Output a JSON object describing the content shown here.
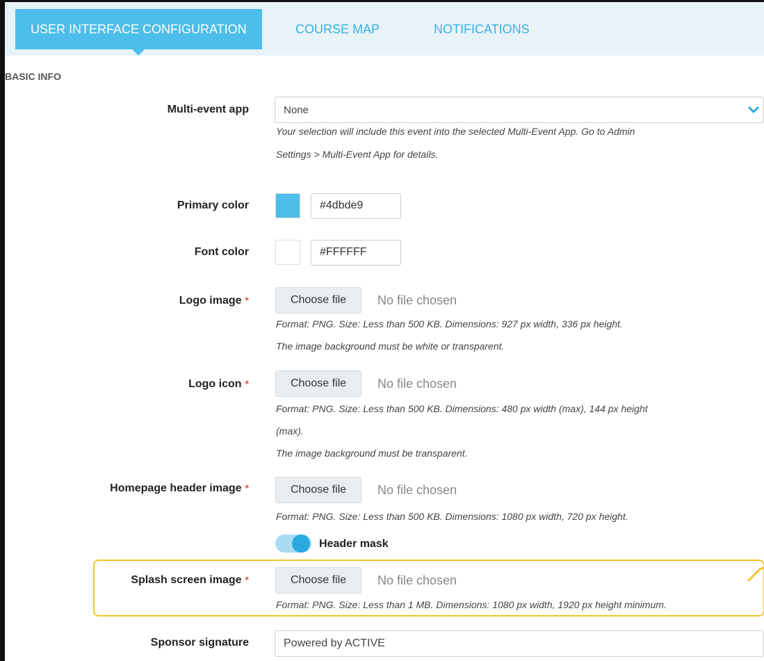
{
  "tabs": [
    {
      "label": "USER INTERFACE CONFIGURATION",
      "active": true
    },
    {
      "label": "COURSE MAP",
      "active": false
    },
    {
      "label": "NOTIFICATIONS",
      "active": false
    }
  ],
  "section_title": "BASIC INFO",
  "multi_event": {
    "label": "Multi-event app",
    "value": "None",
    "help_line1": "Your selection will include this event into the selected Multi-Event App. Go to Admin",
    "help_line2": "Settings > Multi-Event App for details."
  },
  "primary_color": {
    "label": "Primary color",
    "value": "#4dbde9",
    "swatch": "#4dbde9"
  },
  "font_color": {
    "label": "Font color",
    "value": "#FFFFFF",
    "swatch": "#FFFFFF"
  },
  "required_mark": "*",
  "file_button": "Choose file",
  "no_file": "No file chosen",
  "logo_image": {
    "label": "Logo image",
    "help_line1": "Format: PNG. Size: Less than 500 KB. Dimensions: 927 px width, 336 px height.",
    "help_line2": "The image background must be white or transparent."
  },
  "logo_icon": {
    "label": "Logo icon",
    "help_line1": "Format: PNG. Size: Less than 500 KB. Dimensions: 480 px width (max), 144 px height",
    "help_line2": "(max).",
    "help_line3": "The image background must be transparent."
  },
  "homepage_header": {
    "label": "Homepage header image",
    "help_line1": "Format: PNG. Size: Less than 500 KB. Dimensions: 1080 px width, 720 px height.",
    "toggle_label": "Header mask",
    "toggle_on": true
  },
  "splash_screen": {
    "label": "Splash screen image",
    "help_line1": "Format: PNG. Size: Less than 1 MB. Dimensions: 1080 px width, 1920 px height minimum."
  },
  "sponsor": {
    "label": "Sponsor signature",
    "value": "Powered by ACTIVE"
  },
  "colors": {
    "accent": "#4dbde9",
    "highlight": "#f2c232",
    "required": "#e05a3a"
  }
}
